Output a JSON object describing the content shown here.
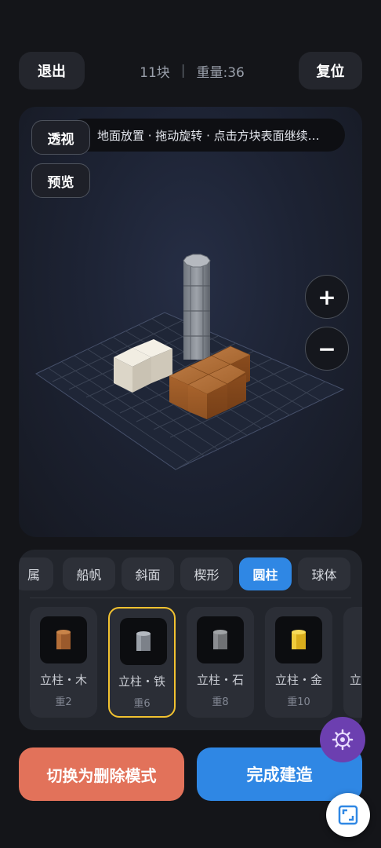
{
  "header": {
    "exit_label": "退出",
    "block_count": "11块",
    "weight": "重量:36",
    "reset_label": "复位"
  },
  "viewport": {
    "hint": "地面放置 · 拖动旋转 · 点击方块表面继续…",
    "perspective_label": "透视",
    "preview_label": "预览",
    "zoom_in": "+",
    "zoom_out": "−"
  },
  "tabs": [
    {
      "label": "属",
      "active": false
    },
    {
      "label": "船帆",
      "active": false
    },
    {
      "label": "斜面",
      "active": false
    },
    {
      "label": "楔形",
      "active": false
    },
    {
      "label": "圆柱",
      "active": true
    },
    {
      "label": "球体",
      "active": false
    }
  ],
  "items": [
    {
      "name": "立柱・木",
      "weight": "重2",
      "color": "#9b5a2c",
      "selected": false
    },
    {
      "name": "立柱・铁",
      "weight": "重6",
      "color": "#8a8f96",
      "selected": true
    },
    {
      "name": "立柱・石",
      "weight": "重8",
      "color": "#7d7f82",
      "selected": false
    },
    {
      "name": "立柱・金",
      "weight": "重10",
      "color": "#e8c02a",
      "selected": false
    },
    {
      "name": "立",
      "weight": "",
      "color": "#555",
      "selected": false
    }
  ],
  "actions": {
    "delete_mode": "切换为删除模式",
    "finish": "完成建造"
  },
  "colors": {
    "accent": "#2f87e4",
    "danger": "#e2725a",
    "selected_border": "#f2c230",
    "fab_purple": "#6c3fb0"
  },
  "icons": {
    "settings": "gear-icon",
    "corner": "frame-corner-icon"
  }
}
